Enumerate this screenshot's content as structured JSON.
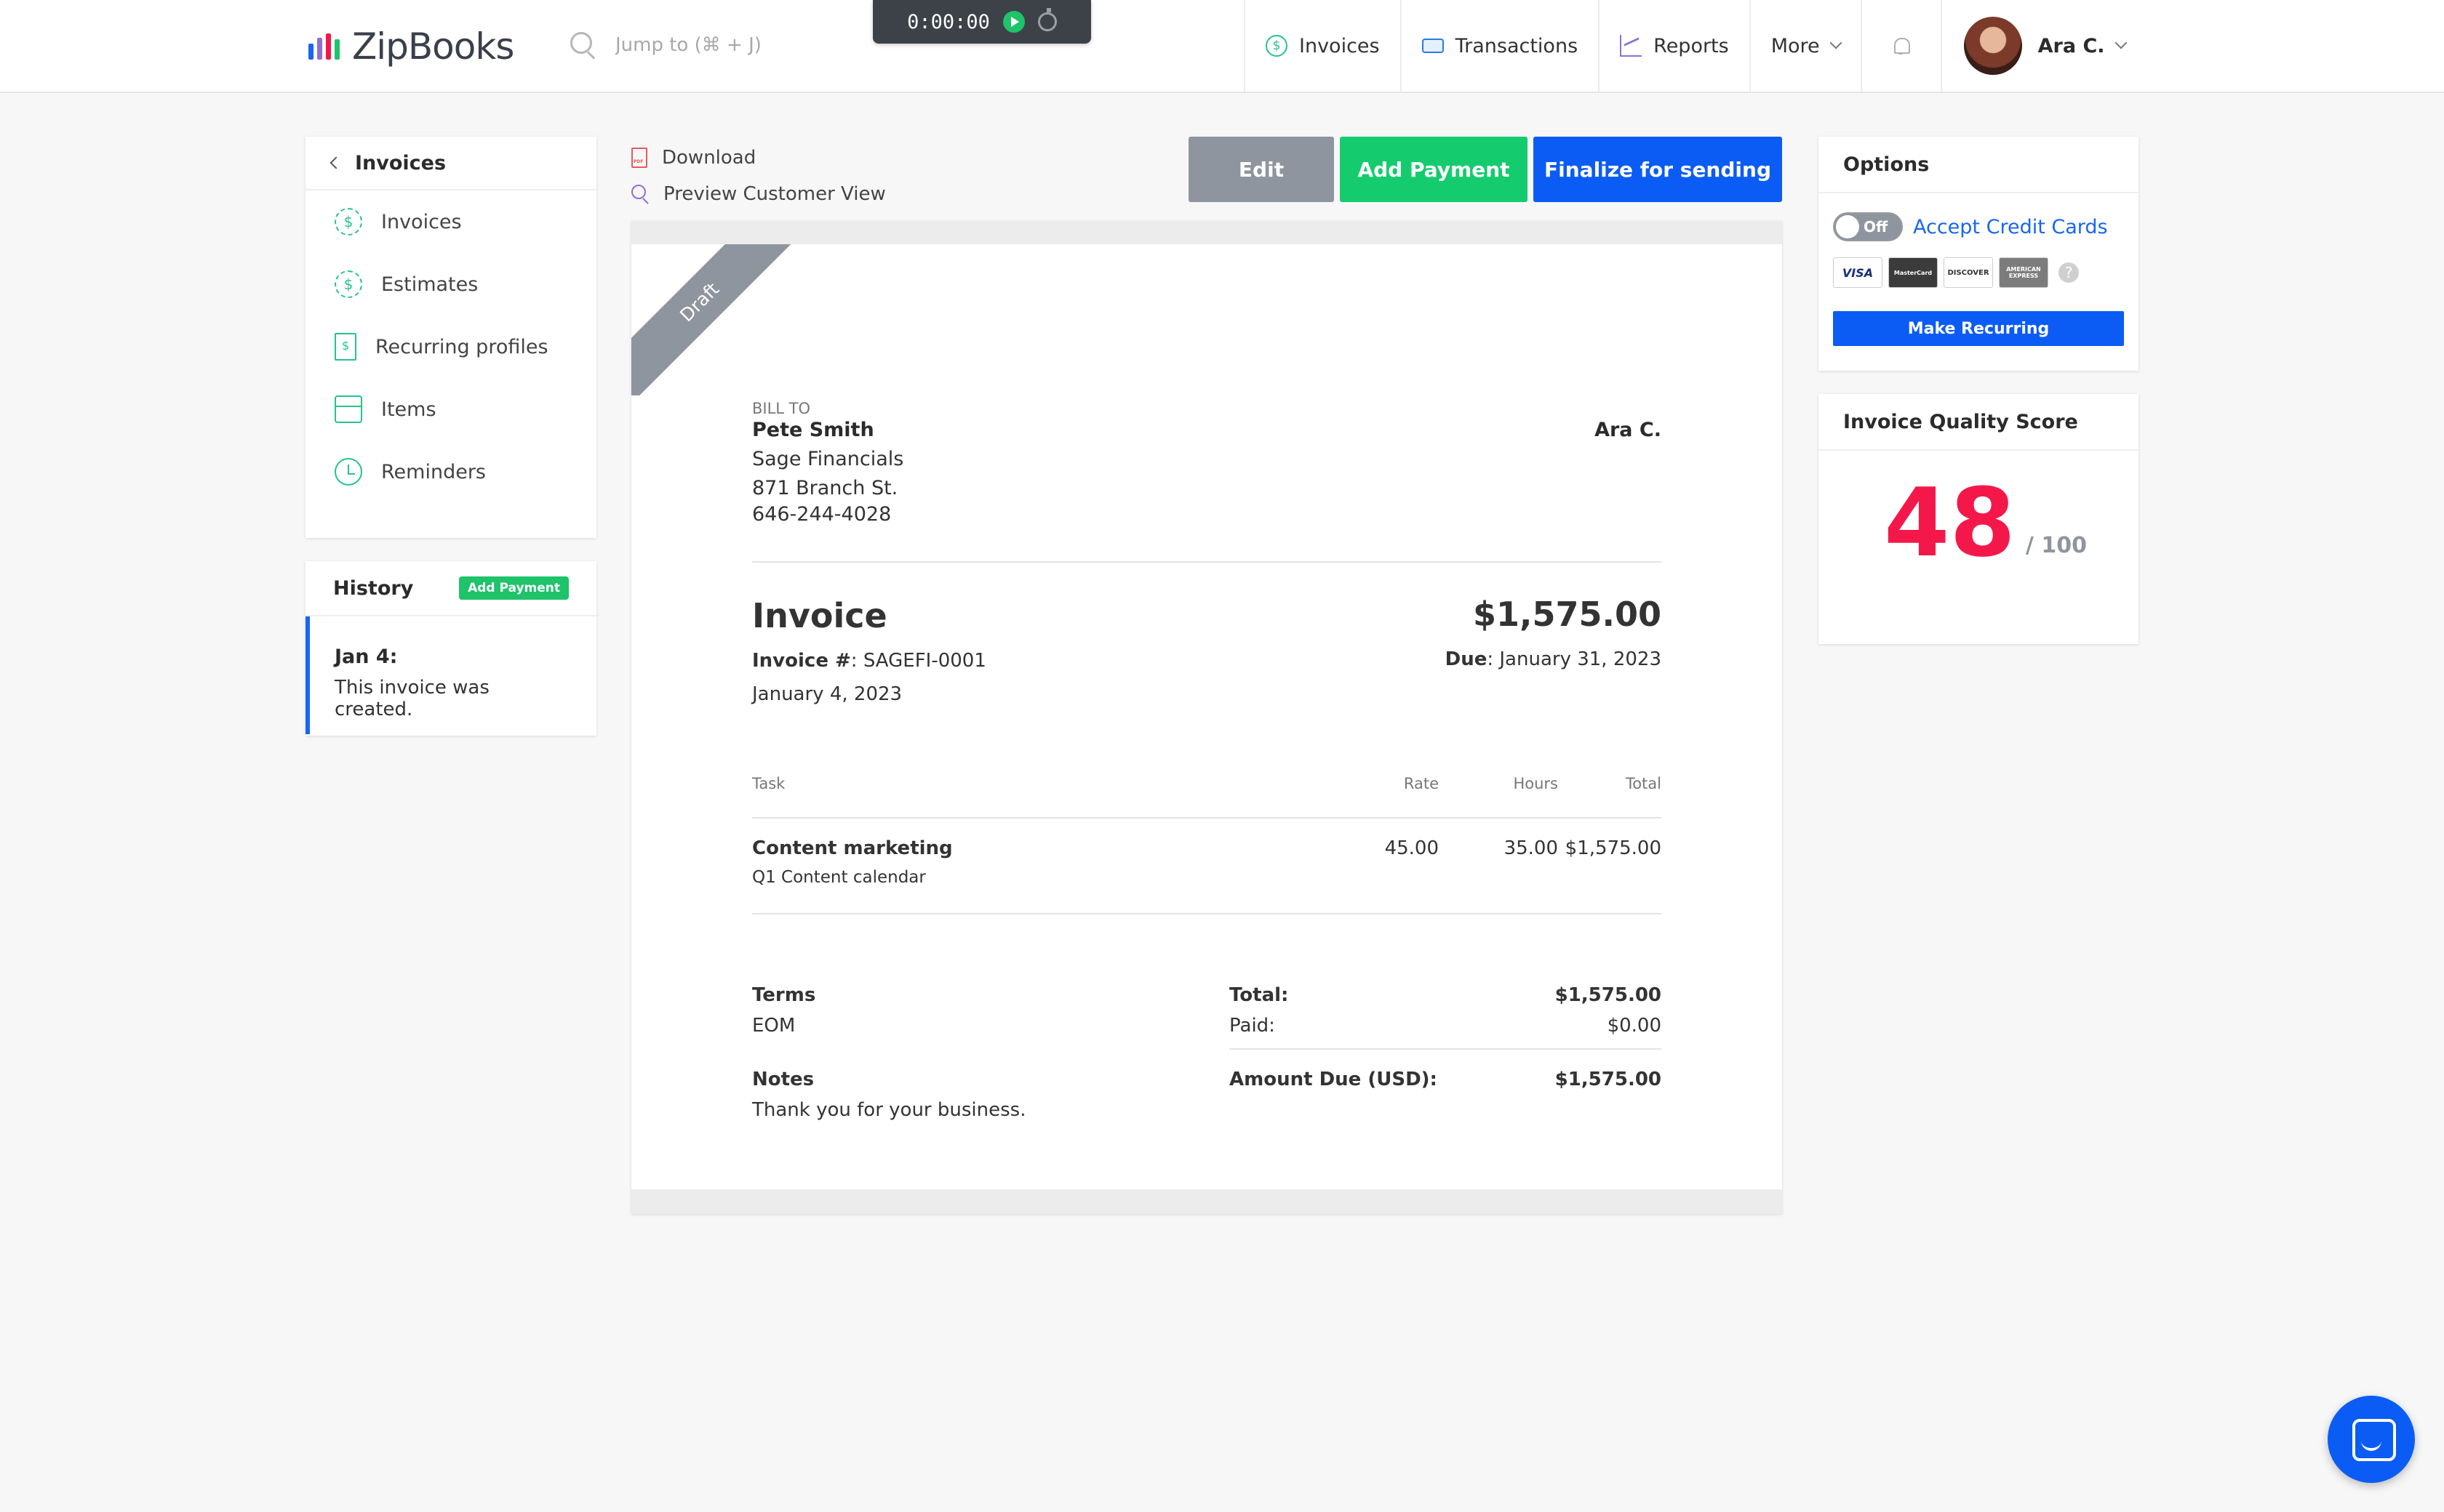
{
  "brand": {
    "name": "ZipBooks",
    "bar_colors": [
      "#1866f2",
      "#8f6ed5",
      "#f4184a",
      "#1ec36a"
    ]
  },
  "search": {
    "placeholder": "Jump to (⌘ + J)"
  },
  "timer": {
    "time": "0:00:00"
  },
  "nav": {
    "invoices": "Invoices",
    "transactions": "Transactions",
    "reports": "Reports",
    "more": "More",
    "user": "Ara C."
  },
  "sidebar": {
    "back_label": "Invoices",
    "items": [
      {
        "label": "Invoices",
        "icon": "dollar-circle-icon"
      },
      {
        "label": "Estimates",
        "icon": "dollar-dashed-icon"
      },
      {
        "label": "Recurring profiles",
        "icon": "recurring-doc-icon"
      },
      {
        "label": "Items",
        "icon": "box-icon"
      },
      {
        "label": "Reminders",
        "icon": "alarm-clock-icon"
      }
    ]
  },
  "history": {
    "title": "History",
    "add_payment": "Add Payment",
    "entries": [
      {
        "date": "Jan 4:",
        "text": "This invoice was created."
      }
    ]
  },
  "actions": {
    "download": "Download",
    "preview": "Preview Customer View",
    "edit": "Edit",
    "add_payment": "Add Payment",
    "finalize": "Finalize for sending"
  },
  "invoice": {
    "ribbon": "Draft",
    "bill_to_label": "BILL TO",
    "client": {
      "name": "Pete Smith",
      "company": "Sage Financials",
      "address": "871 Branch St.",
      "phone": "646-244-4028"
    },
    "from_name": "Ara C.",
    "title": "Invoice",
    "amount": "$1,575.00",
    "number_label": "Invoice #",
    "number": ": SAGEFI-0001",
    "date": "January 4, 2023",
    "due_label": "Due",
    "due_date": ": January 31, 2023",
    "columns": {
      "task": "Task",
      "rate": "Rate",
      "hours": "Hours",
      "total": "Total"
    },
    "lines": [
      {
        "task": "Content marketing",
        "description": "Q1 Content calendar",
        "rate": "45.00",
        "hours": "35.00",
        "total": "$1,575.00"
      }
    ],
    "terms_label": "Terms",
    "terms": "EOM",
    "notes_label": "Notes",
    "notes": "Thank you for your business.",
    "totals": {
      "total_label": "Total:",
      "total": "$1,575.00",
      "paid_label": "Paid:",
      "paid": "$0.00",
      "due_label": "Amount Due (USD):",
      "due": "$1,575.00"
    }
  },
  "options": {
    "title": "Options",
    "toggle_state": "Off",
    "accept_cards": "Accept Credit Cards",
    "card_logos": [
      "VISA",
      "MasterCard",
      "DISCOVER",
      "AMERICAN EXPRESS"
    ],
    "help": "?",
    "make_recurring": "Make Recurring"
  },
  "quality": {
    "title": "Invoice Quality Score",
    "score": "48",
    "max": "/ 100",
    "score_color": "#f4184a"
  }
}
